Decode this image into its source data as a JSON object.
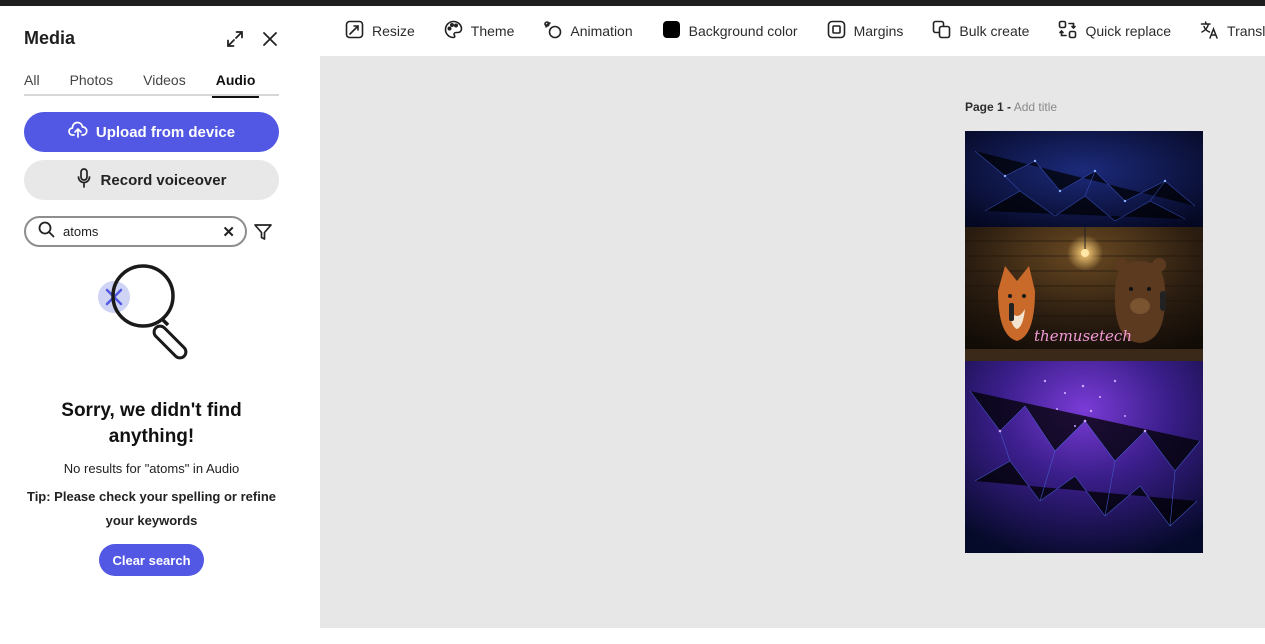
{
  "panel": {
    "title": "Media",
    "tabs": [
      "All",
      "Photos",
      "Videos",
      "Audio"
    ],
    "active_tab": "Audio",
    "upload_label": "Upload from device",
    "record_label": "Record voiceover",
    "search": {
      "value": "atoms",
      "placeholder": "Search"
    },
    "empty": {
      "title": "Sorry, we didn't find anything!",
      "message": "No results for \"atoms\" in Audio",
      "tip": "Tip: Please check your spelling or refine your keywords"
    },
    "clear_search_label": "Clear search"
  },
  "toolbar": {
    "items": [
      {
        "label": "Resize",
        "icon": "resize-icon"
      },
      {
        "label": "Theme",
        "icon": "palette-icon"
      },
      {
        "label": "Animation",
        "icon": "animation-icon"
      },
      {
        "label": "Background color",
        "icon": "color-swatch-icon"
      },
      {
        "label": "Margins",
        "icon": "margins-icon"
      },
      {
        "label": "Bulk create",
        "icon": "bulk-create-icon"
      },
      {
        "label": "Quick replace",
        "icon": "quick-replace-icon"
      },
      {
        "label": "Translate",
        "icon": "translate-icon"
      }
    ]
  },
  "canvas": {
    "page_prefix": "Page 1 -",
    "add_title": "Add title",
    "design_text": "themusetech"
  },
  "colors": {
    "accent": "#5258e4",
    "canvas_bg": "#e7e7e7",
    "design_bg": "#070b2a",
    "neon_text": "#f39ad8"
  }
}
